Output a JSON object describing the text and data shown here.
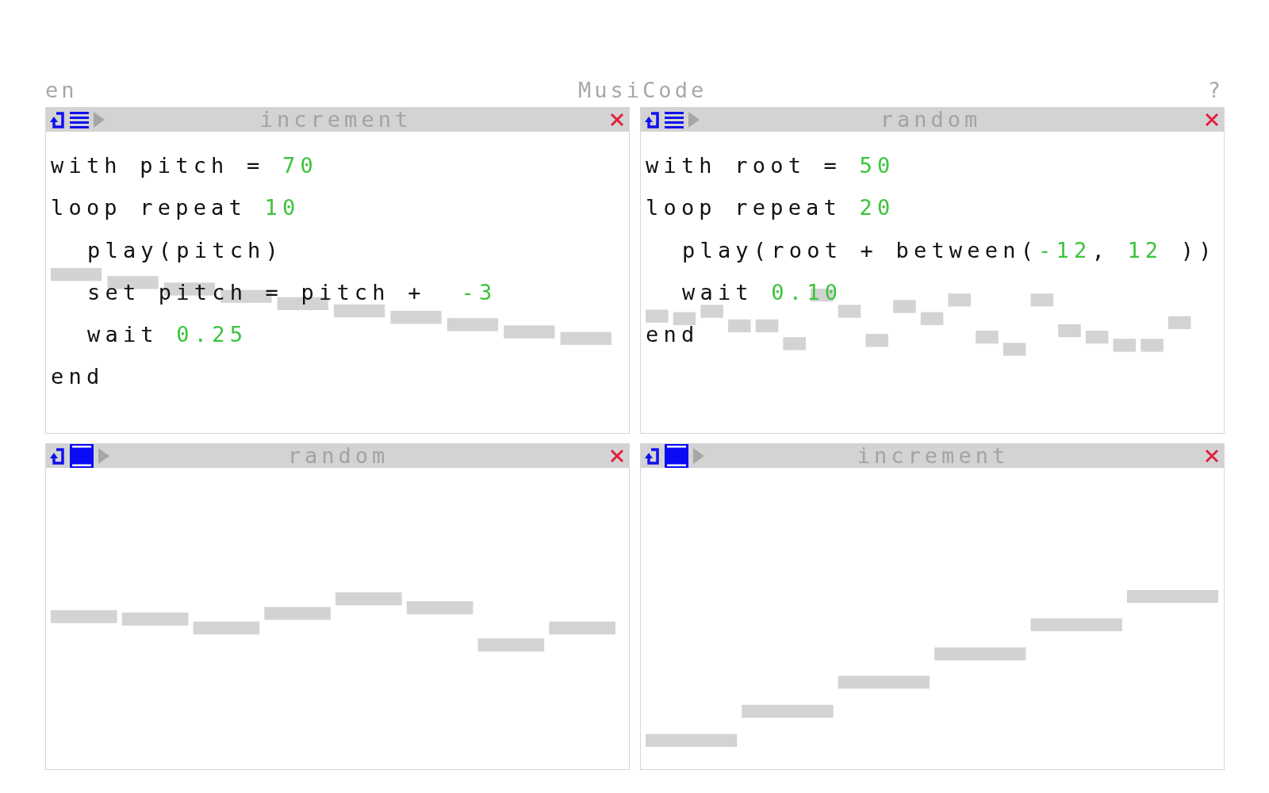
{
  "header": {
    "language": "en",
    "title": "MusiCode",
    "help": "?"
  },
  "panels": [
    {
      "title": "increment",
      "kind": "code",
      "code": [
        {
          "tokens": [
            {
              "text": "with pitch = ",
              "kind": "plain"
            },
            {
              "text": "70",
              "kind": "number"
            }
          ]
        },
        {
          "tokens": [
            {
              "text": "loop repeat ",
              "kind": "plain"
            },
            {
              "text": "10",
              "kind": "number"
            }
          ],
          "children": [
            {
              "tokens": [
                {
                  "text": "play(pitch)",
                  "kind": "plain"
                }
              ]
            },
            {
              "tokens": [
                {
                  "text": "set pitch = pitch +  ",
                  "kind": "plain"
                },
                {
                  "text": "-3",
                  "kind": "number"
                }
              ]
            },
            {
              "tokens": [
                {
                  "text": "wait ",
                  "kind": "plain"
                },
                {
                  "text": "0.25",
                  "kind": "number"
                }
              ]
            }
          ]
        },
        {
          "tokens": [
            {
              "text": "end",
              "kind": "plain"
            }
          ]
        }
      ]
    },
    {
      "title": "random",
      "kind": "code",
      "code": [
        {
          "tokens": [
            {
              "text": "with root = ",
              "kind": "plain"
            },
            {
              "text": "50",
              "kind": "number"
            }
          ]
        },
        {
          "tokens": [
            {
              "text": "loop repeat ",
              "kind": "plain"
            },
            {
              "text": "20",
              "kind": "number"
            }
          ],
          "children": [
            {
              "tokens": [
                {
                  "text": "play(root + between(",
                  "kind": "plain"
                },
                {
                  "text": "-12",
                  "kind": "number"
                },
                {
                  "text": ", ",
                  "kind": "plain"
                },
                {
                  "text": "12",
                  "kind": "number"
                },
                {
                  "text": " ))",
                  "kind": "plain"
                }
              ]
            },
            {
              "tokens": [
                {
                  "text": "wait ",
                  "kind": "plain"
                },
                {
                  "text": "0.10",
                  "kind": "number"
                }
              ]
            }
          ]
        },
        {
          "tokens": [
            {
              "text": "end",
              "kind": "plain"
            }
          ]
        }
      ]
    },
    {
      "title": "random",
      "kind": "roll"
    },
    {
      "title": "increment",
      "kind": "roll"
    }
  ]
}
